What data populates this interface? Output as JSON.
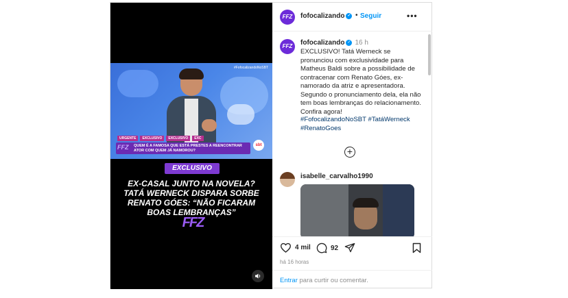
{
  "media": {
    "video_tag": "#FofocalizandoNoSBT",
    "news_strip": [
      "URGENTE",
      "EXCLUSIVO",
      "EXCLUSIVO",
      "EXC"
    ],
    "lower_third": "QUEM É A FAMOSA QUE ESTÁ PRESTES A REENCONTRAR ATOR COM QUEM JÁ NAMOROU?",
    "mini_logo": "FFZ",
    "channel_logo": "sbt",
    "badge": "EXCLUSIVO",
    "headline": "EX-CASAL JUNTO NA NOVELA? TATÁ WERNECK DISPARA SORBE RENATO GÓES: “NÃO FICARAM BOAS LEMBRANÇAS”",
    "brand_logo": "FFZ"
  },
  "header": {
    "avatar_text": "FFZ",
    "username": "fofocalizando",
    "separator": "•",
    "follow_label": "Seguir",
    "more_label": "•••"
  },
  "caption": {
    "username": "fofocalizando",
    "time": "16 h",
    "text": "EXCLUSIVO! Tatá Werneck se pronunciou com exclusividade para Matheus Baldi sobre a possibilidade de contracenar com Renato Góes, ex-namorado da atriz e apresentadora. Segundo o pronunciamento dela, ela não tem boas lembranças do relacionamento. Confira agora!",
    "hashtags": "#FofocalizandoNoSBT #TatáWerneck #RenatoGoes"
  },
  "comment": {
    "username": "isabelle_carvalho1990"
  },
  "actions": {
    "likes": "4 mil",
    "comments": "92",
    "time_ago": "há 16 horas"
  },
  "add_comment": {
    "link": "Entrar",
    "rest": " para curtir ou comentar."
  },
  "colors": {
    "brand_purple": "#6c2bd9",
    "link_blue": "#0095f6",
    "hashtag_blue": "#00376b"
  }
}
